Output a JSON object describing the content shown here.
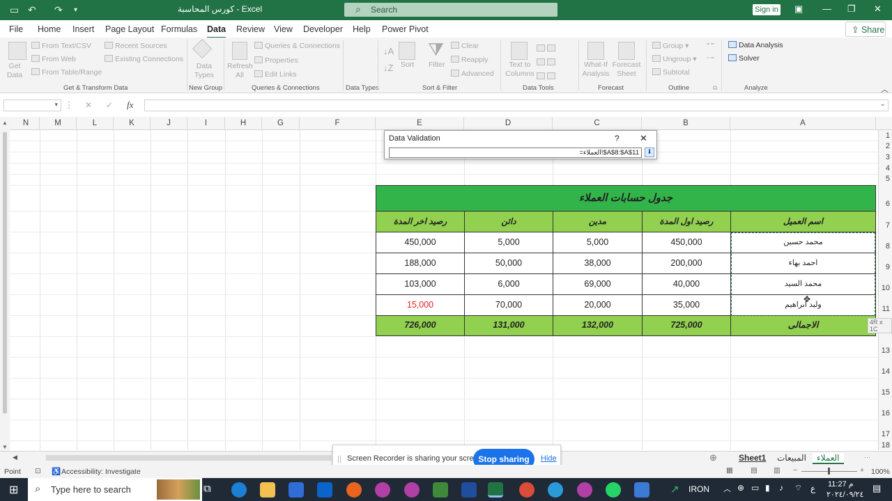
{
  "titlebar": {
    "doc_title": "كورس المحاسبة  -  Excel",
    "search_placeholder": "Search",
    "signin": "Sign in"
  },
  "menu": {
    "tabs": [
      "File",
      "Home",
      "Insert",
      "Page Layout",
      "Formulas",
      "Data",
      "Review",
      "View",
      "Developer",
      "Help",
      "Power Pivot"
    ],
    "active": "Data",
    "share": "Share"
  },
  "ribbon": {
    "get_data": "Get Data",
    "from_text": "From Text/CSV",
    "from_web": "From Web",
    "from_table": "From Table/Range",
    "recent": "Recent Sources",
    "existing": "Existing Connections",
    "data_types": "Data Types",
    "refresh": "Refresh All",
    "queries": "Queries & Connections",
    "properties": "Properties",
    "edit_links": "Edit Links",
    "sort": "Sort",
    "filter": "Filter",
    "clear": "Clear",
    "reapply": "Reapply",
    "advanced": "Advanced",
    "text_columns": "Text to Columns",
    "whatif": "What-If Analysis",
    "forecast": "Forecast Sheet",
    "group": "Group",
    "ungroup": "Ungroup",
    "subtotal": "Subtotal",
    "data_analysis": "Data Analysis",
    "solver": "Solver",
    "groups": {
      "gt": "Get & Transform Data",
      "ng": "New Group",
      "qc": "Queries & Connections",
      "dt": "Data Types",
      "sf": "Sort & Filter",
      "tools": "Data Tools",
      "fc": "Forecast",
      "ol": "Outline",
      "an": "Analyze"
    }
  },
  "formula": {
    "fx": "fx"
  },
  "columns": [
    "N",
    "M",
    "L",
    "K",
    "J",
    "I",
    "H",
    "G",
    "F",
    "E",
    "D",
    "C",
    "B",
    "A"
  ],
  "rows": [
    "1",
    "2",
    "3",
    "4",
    "5",
    "6",
    "7",
    "8",
    "9",
    "10",
    "11",
    "12",
    "13",
    "14",
    "15",
    "16",
    "17",
    "18"
  ],
  "dialog": {
    "title": "Data Validation",
    "help": "?",
    "ref": "=العملاء!$A$8:$A$11"
  },
  "table": {
    "title": "جدول حسابات العملاء",
    "headers": [
      "اسم العميل",
      "رصيد اول المدة",
      "مدين",
      "دائن",
      "رصيد اخر المدة"
    ],
    "rows": [
      [
        "محمد حسين",
        "450,000",
        "5,000",
        "5,000",
        "450,000"
      ],
      [
        "احمد بهاء",
        "200,000",
        "38,000",
        "50,000",
        "188,000"
      ],
      [
        "محمد السيد",
        "40,000",
        "69,000",
        "6,000",
        "103,000"
      ],
      [
        "وليد ابراهيم",
        "35,000",
        "20,000",
        "70,000",
        "15,000"
      ]
    ],
    "totals": [
      "الاجمالى",
      "725,000",
      "132,000",
      "131,000",
      "726,000"
    ],
    "size_tip": "4R x 1C"
  },
  "sheets": {
    "tabs": [
      "Sheet1",
      "المبيعات",
      "العملاء"
    ],
    "active": "العملاء"
  },
  "sharing": {
    "text": "Screen Recorder is sharing your screen.",
    "stop": "Stop sharing",
    "hide": "Hide"
  },
  "status": {
    "mode": "Point",
    "accessibility": "Accessibility: Investigate",
    "zoom": "100%"
  },
  "taskbar": {
    "search": "Type here to search",
    "iron": "IRON",
    "time": "11:27 م",
    "date": "٢٠٢٤/٠٩/٢٤",
    "lang": "ع"
  }
}
